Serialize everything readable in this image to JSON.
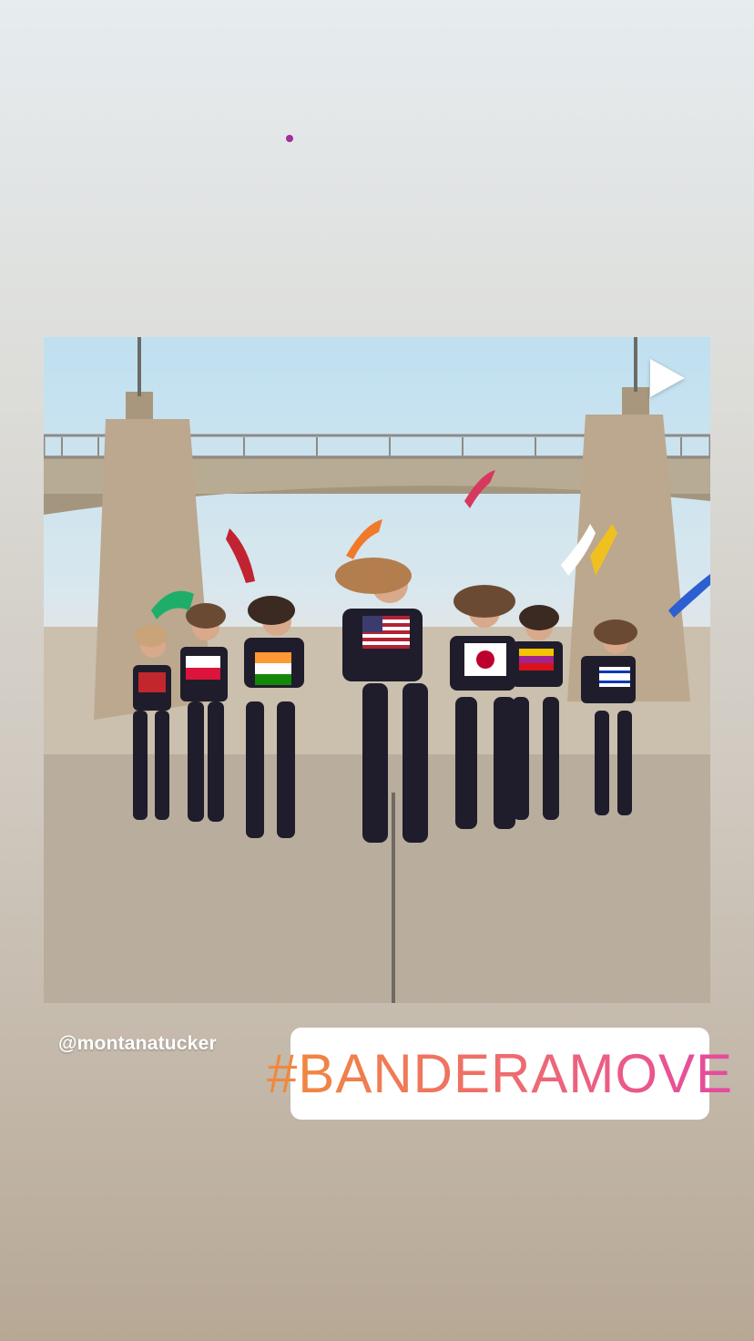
{
  "story": {
    "mention": "@montanatucker",
    "hashtag": "#BANDERAMOVE",
    "media_type": "video",
    "play_icon": "play-icon"
  },
  "colors": {
    "hashtag_gradient_start": "#f08a3a",
    "hashtag_gradient_end": "#e44aa0",
    "background_top": "#e6ecef",
    "background_bottom": "#b7a895"
  }
}
